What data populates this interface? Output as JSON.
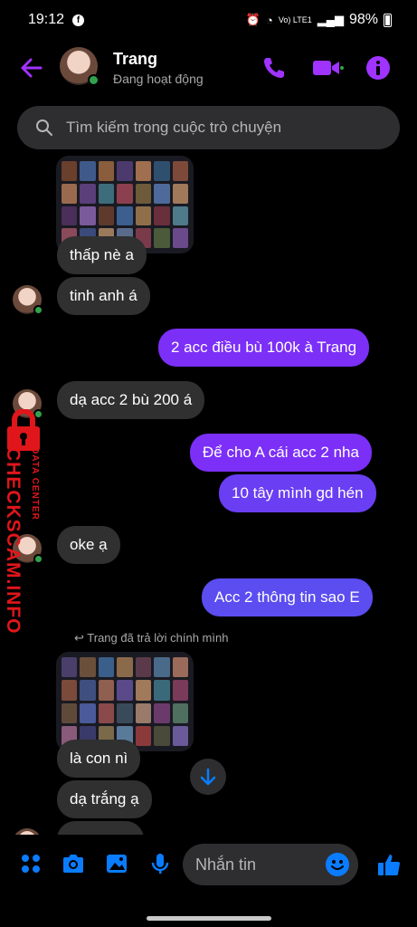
{
  "status_bar": {
    "time": "19:12",
    "network": "Vo) LTE1",
    "battery": "98%"
  },
  "header": {
    "name": "Trang",
    "status": "Đang hoạt động"
  },
  "search": {
    "placeholder": "Tìm kiếm trong cuộc trò chuyện"
  },
  "messages": {
    "m1": "thấp nè a",
    "m2": "tinh anh á",
    "m3": "2 acc điều bù 100k à Trang",
    "m4": "dạ acc 2 bù 200 á",
    "m5": "Để cho A cái acc 2 nha",
    "m6": "10 tây mình gd hén",
    "m7": "oke ạ",
    "m8": "Acc 2 thông tin sao E",
    "reply_note": "Trang đã trả lời chính mình",
    "m9": "là con nì",
    "m10": "dạ trắng ạ"
  },
  "watermark": {
    "main": "CHECKSCAM.INFO",
    "sub": "DATA CENTER"
  },
  "composer": {
    "placeholder": "Nhắn tin"
  },
  "colors": {
    "outgoing": "#7b2ff7",
    "outgoing_alt": "#5b4df0",
    "incoming": "#303030",
    "accent": "#a033ff",
    "online": "#31a24c",
    "blue": "#0a7cff"
  }
}
